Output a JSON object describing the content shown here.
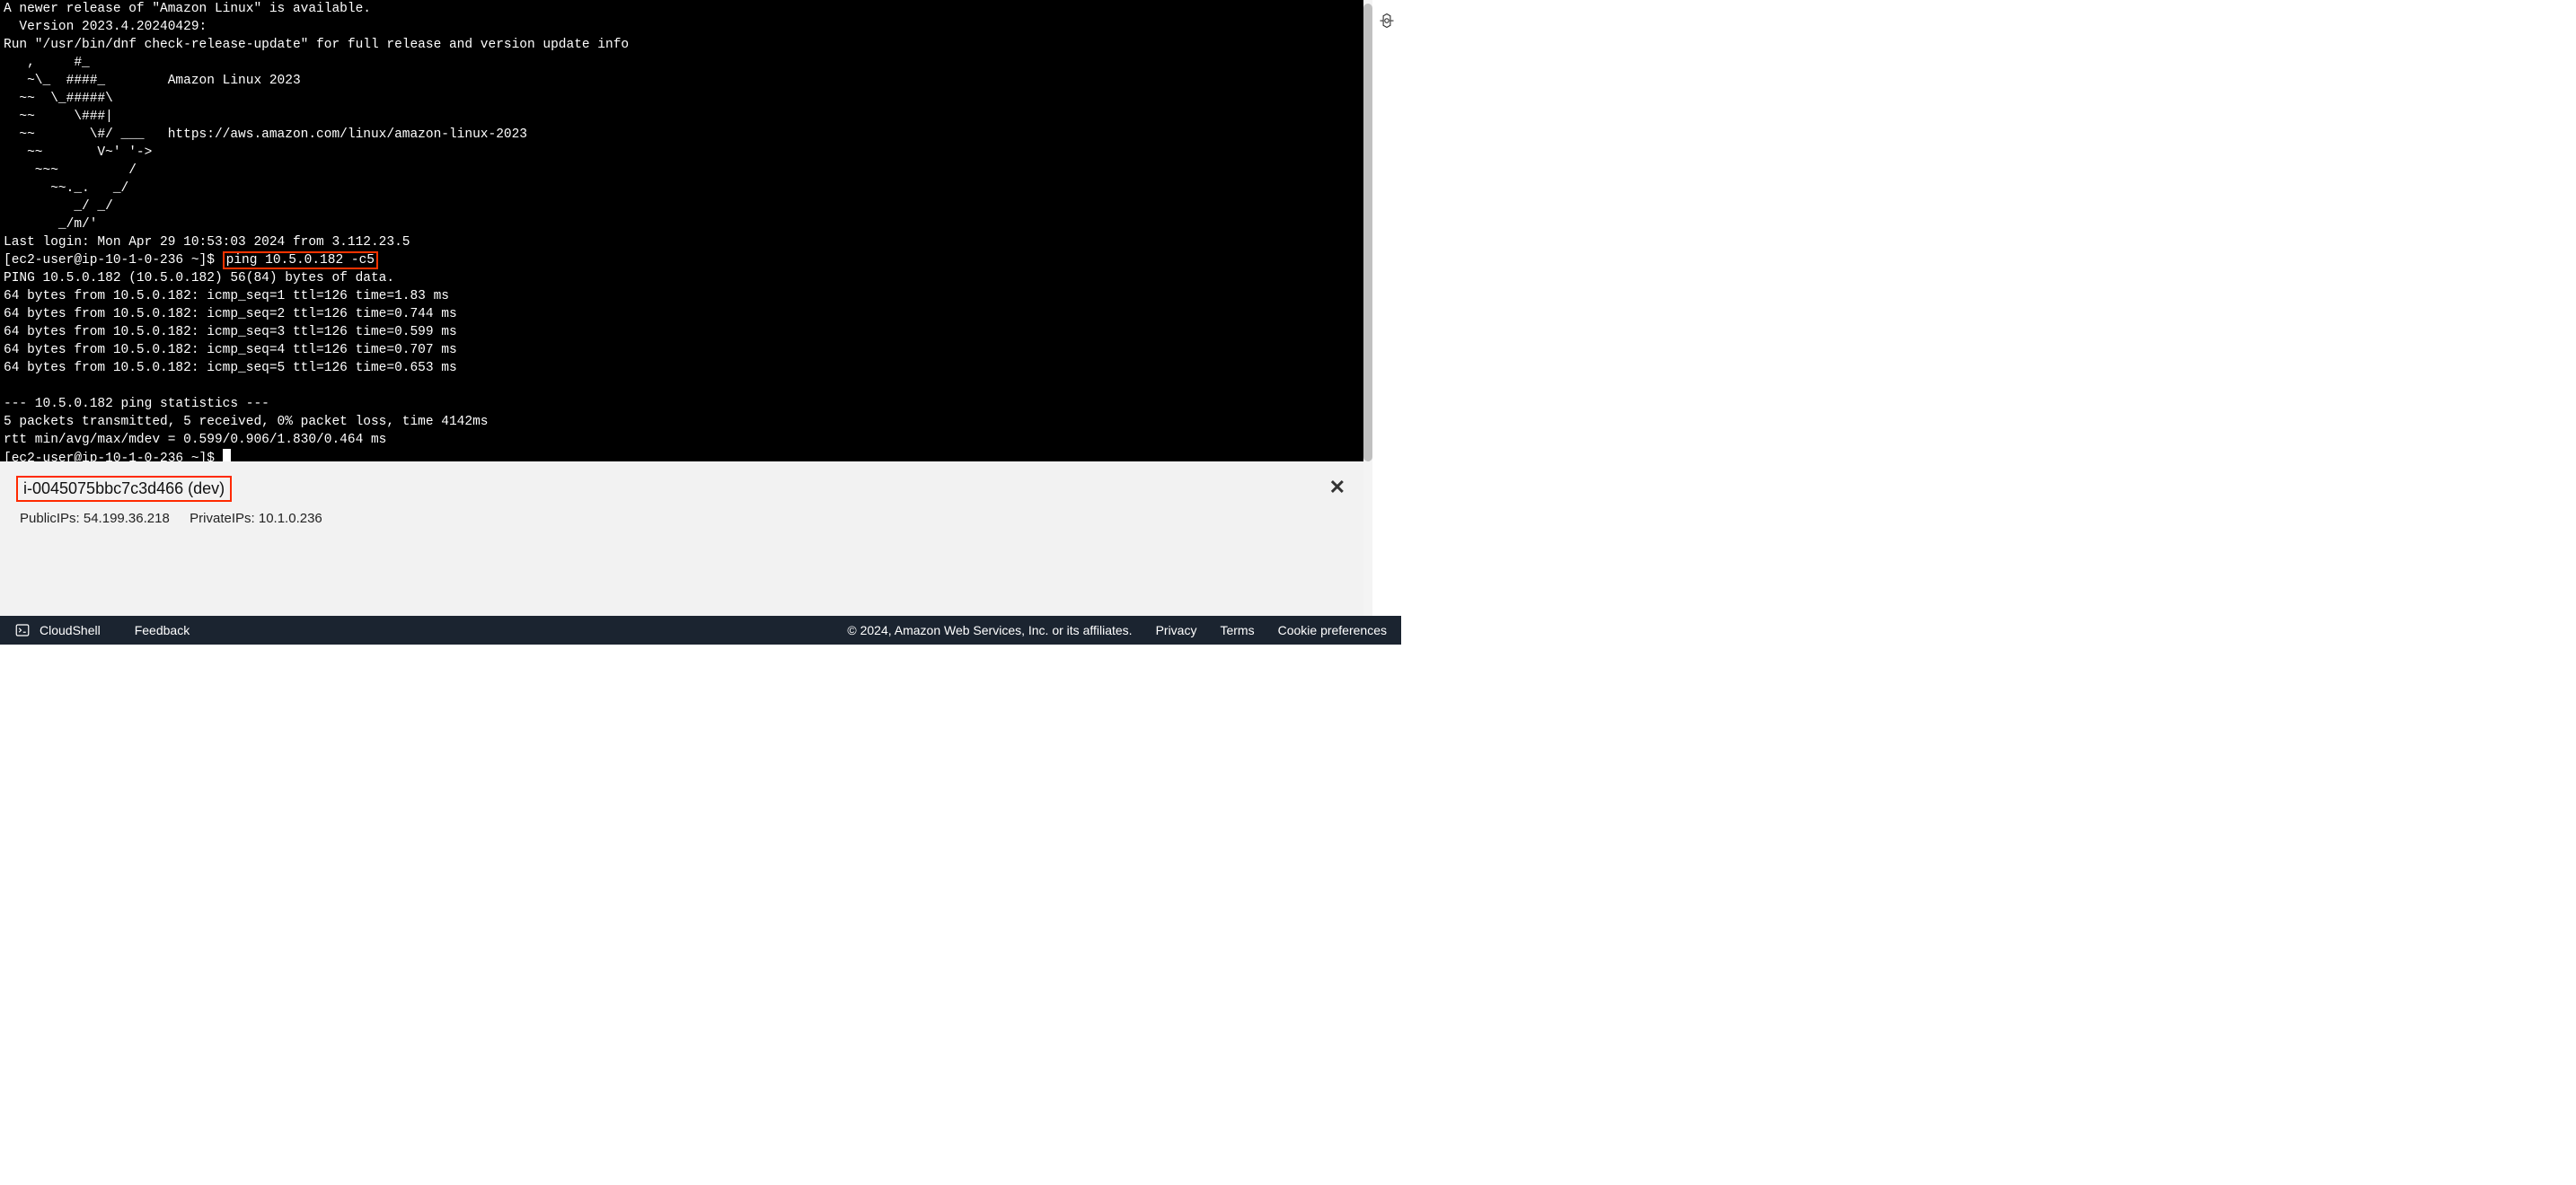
{
  "terminal": {
    "line1": "A newer release of \"Amazon Linux\" is available.",
    "line2": "  Version 2023.4.20240429:",
    "line3": "Run \"/usr/bin/dnf check-release-update\" for full release and version update info",
    "art1": "   ,     #_",
    "art2": "   ~\\_  ####_        Amazon Linux 2023",
    "art3": "  ~~  \\_#####\\",
    "art4": "  ~~     \\###|",
    "art5": "  ~~       \\#/ ___   https://aws.amazon.com/linux/amazon-linux-2023",
    "art6": "   ~~       V~' '->",
    "art7": "    ~~~         /",
    "art8": "      ~~._.   _/",
    "art9": "         _/ _/",
    "art10": "       _/m/'",
    "lastlogin": "Last login: Mon Apr 29 10:53:03 2024 from 3.112.23.5",
    "prompt1_prefix": "[ec2-user@ip-10-1-0-236 ~]$ ",
    "ping_cmd": "ping 10.5.0.182 -c5",
    "ping_hdr": "PING 10.5.0.182 (10.5.0.182) 56(84) bytes of data.",
    "ping1": "64 bytes from 10.5.0.182: icmp_seq=1 ttl=126 time=1.83 ms",
    "ping2": "64 bytes from 10.5.0.182: icmp_seq=2 ttl=126 time=0.744 ms",
    "ping3": "64 bytes from 10.5.0.182: icmp_seq=3 ttl=126 time=0.599 ms",
    "ping4": "64 bytes from 10.5.0.182: icmp_seq=4 ttl=126 time=0.707 ms",
    "ping5": "64 bytes from 10.5.0.182: icmp_seq=5 ttl=126 time=0.653 ms",
    "stats_hdr": "--- 10.5.0.182 ping statistics ---",
    "stats1": "5 packets transmitted, 5 received, 0% packet loss, time 4142ms",
    "stats2": "rtt min/avg/max/mdev = 0.599/0.906/1.830/0.464 ms",
    "prompt2": "[ec2-user@ip-10-1-0-236 ~]$ "
  },
  "info": {
    "instance": "i-0045075bbc7c3d466 (dev)",
    "public_label": "PublicIPs:",
    "public_ip": "54.199.36.218",
    "private_label": "PrivateIPs:",
    "private_ip": "10.1.0.236"
  },
  "footer": {
    "cloudshell": "CloudShell",
    "feedback": "Feedback",
    "copyright": "© 2024, Amazon Web Services, Inc. or its affiliates.",
    "privacy": "Privacy",
    "terms": "Terms",
    "cookie": "Cookie preferences"
  }
}
